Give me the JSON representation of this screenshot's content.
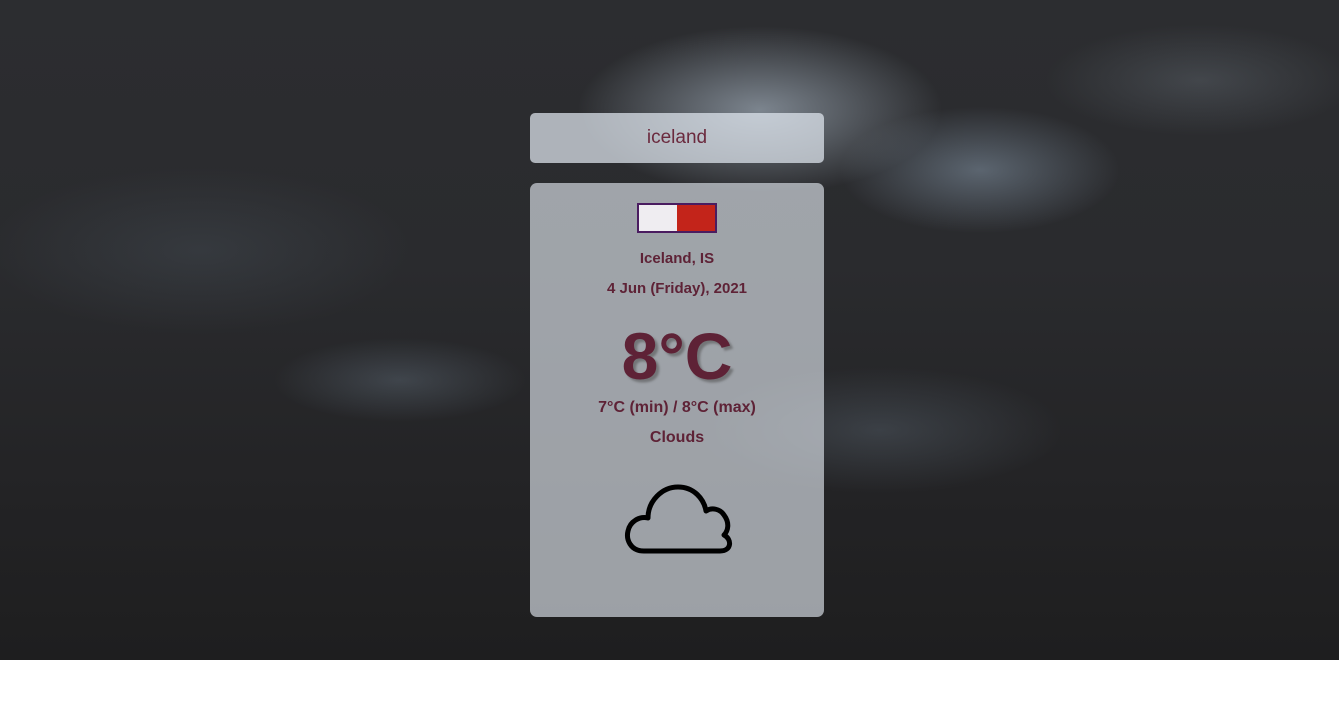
{
  "search": {
    "value": "iceland"
  },
  "weather": {
    "location": "Iceland, IS",
    "date": "4 Jun (Friday), 2021",
    "temperature": "8°C",
    "min_max": "7°C (min) / 8°C (max)",
    "condition": "Clouds",
    "condition_icon": "cloud-icon",
    "flag_icon": "flag-icon",
    "colors": {
      "text": "#5e2236",
      "flag_left": "#efedf1",
      "flag_right": "#c3241a",
      "flag_border": "#4a1c60"
    }
  }
}
